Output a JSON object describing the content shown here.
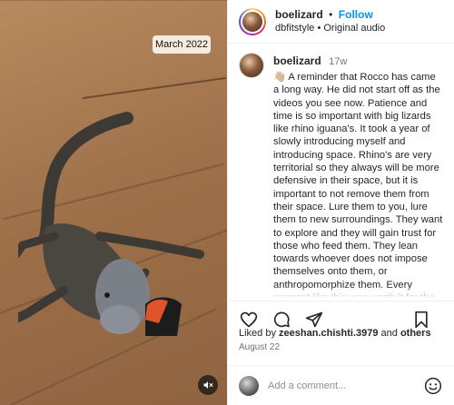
{
  "media": {
    "timestamp_label": "March 2022"
  },
  "header": {
    "username": "boelizard",
    "separator": "•",
    "follow_label": "Follow",
    "subtitle": "dbfitstyle • Original audio"
  },
  "caption": {
    "username": "boelizard",
    "time_ago": "17w",
    "text": "👋🏼 A reminder that Rocco has came a long way. He did not start off as the videos you see now. Patience and time is so important with big lizards like rhino iguana's. It took a year of slowly introducing myself and introducing space. Rhino's are very territorial so they always will be more defensive in their space, but it is important to not remove them from their space. Lure them to you, lure them to new surroundings. They want to explore and they will gain trust for those who feed them. They lean towards whoever does not impose themselves onto them, or anthropomorphize them. Every moment like this was worth it for the relationship we have now. All I can say to everyone who messages me is it takes time."
  },
  "actions": {
    "icons": [
      "heart-icon",
      "comment-icon",
      "share-icon",
      "bookmark-icon"
    ]
  },
  "likes": {
    "prefix": "Liked by ",
    "user": "zeeshan.chishti.3979",
    "middle": " and ",
    "others": "others"
  },
  "date": "August 22",
  "comment": {
    "placeholder": "Add a comment..."
  },
  "colors": {
    "follow_blue": "#0095f6",
    "muted_text": "#737373",
    "border": "#efefef"
  }
}
